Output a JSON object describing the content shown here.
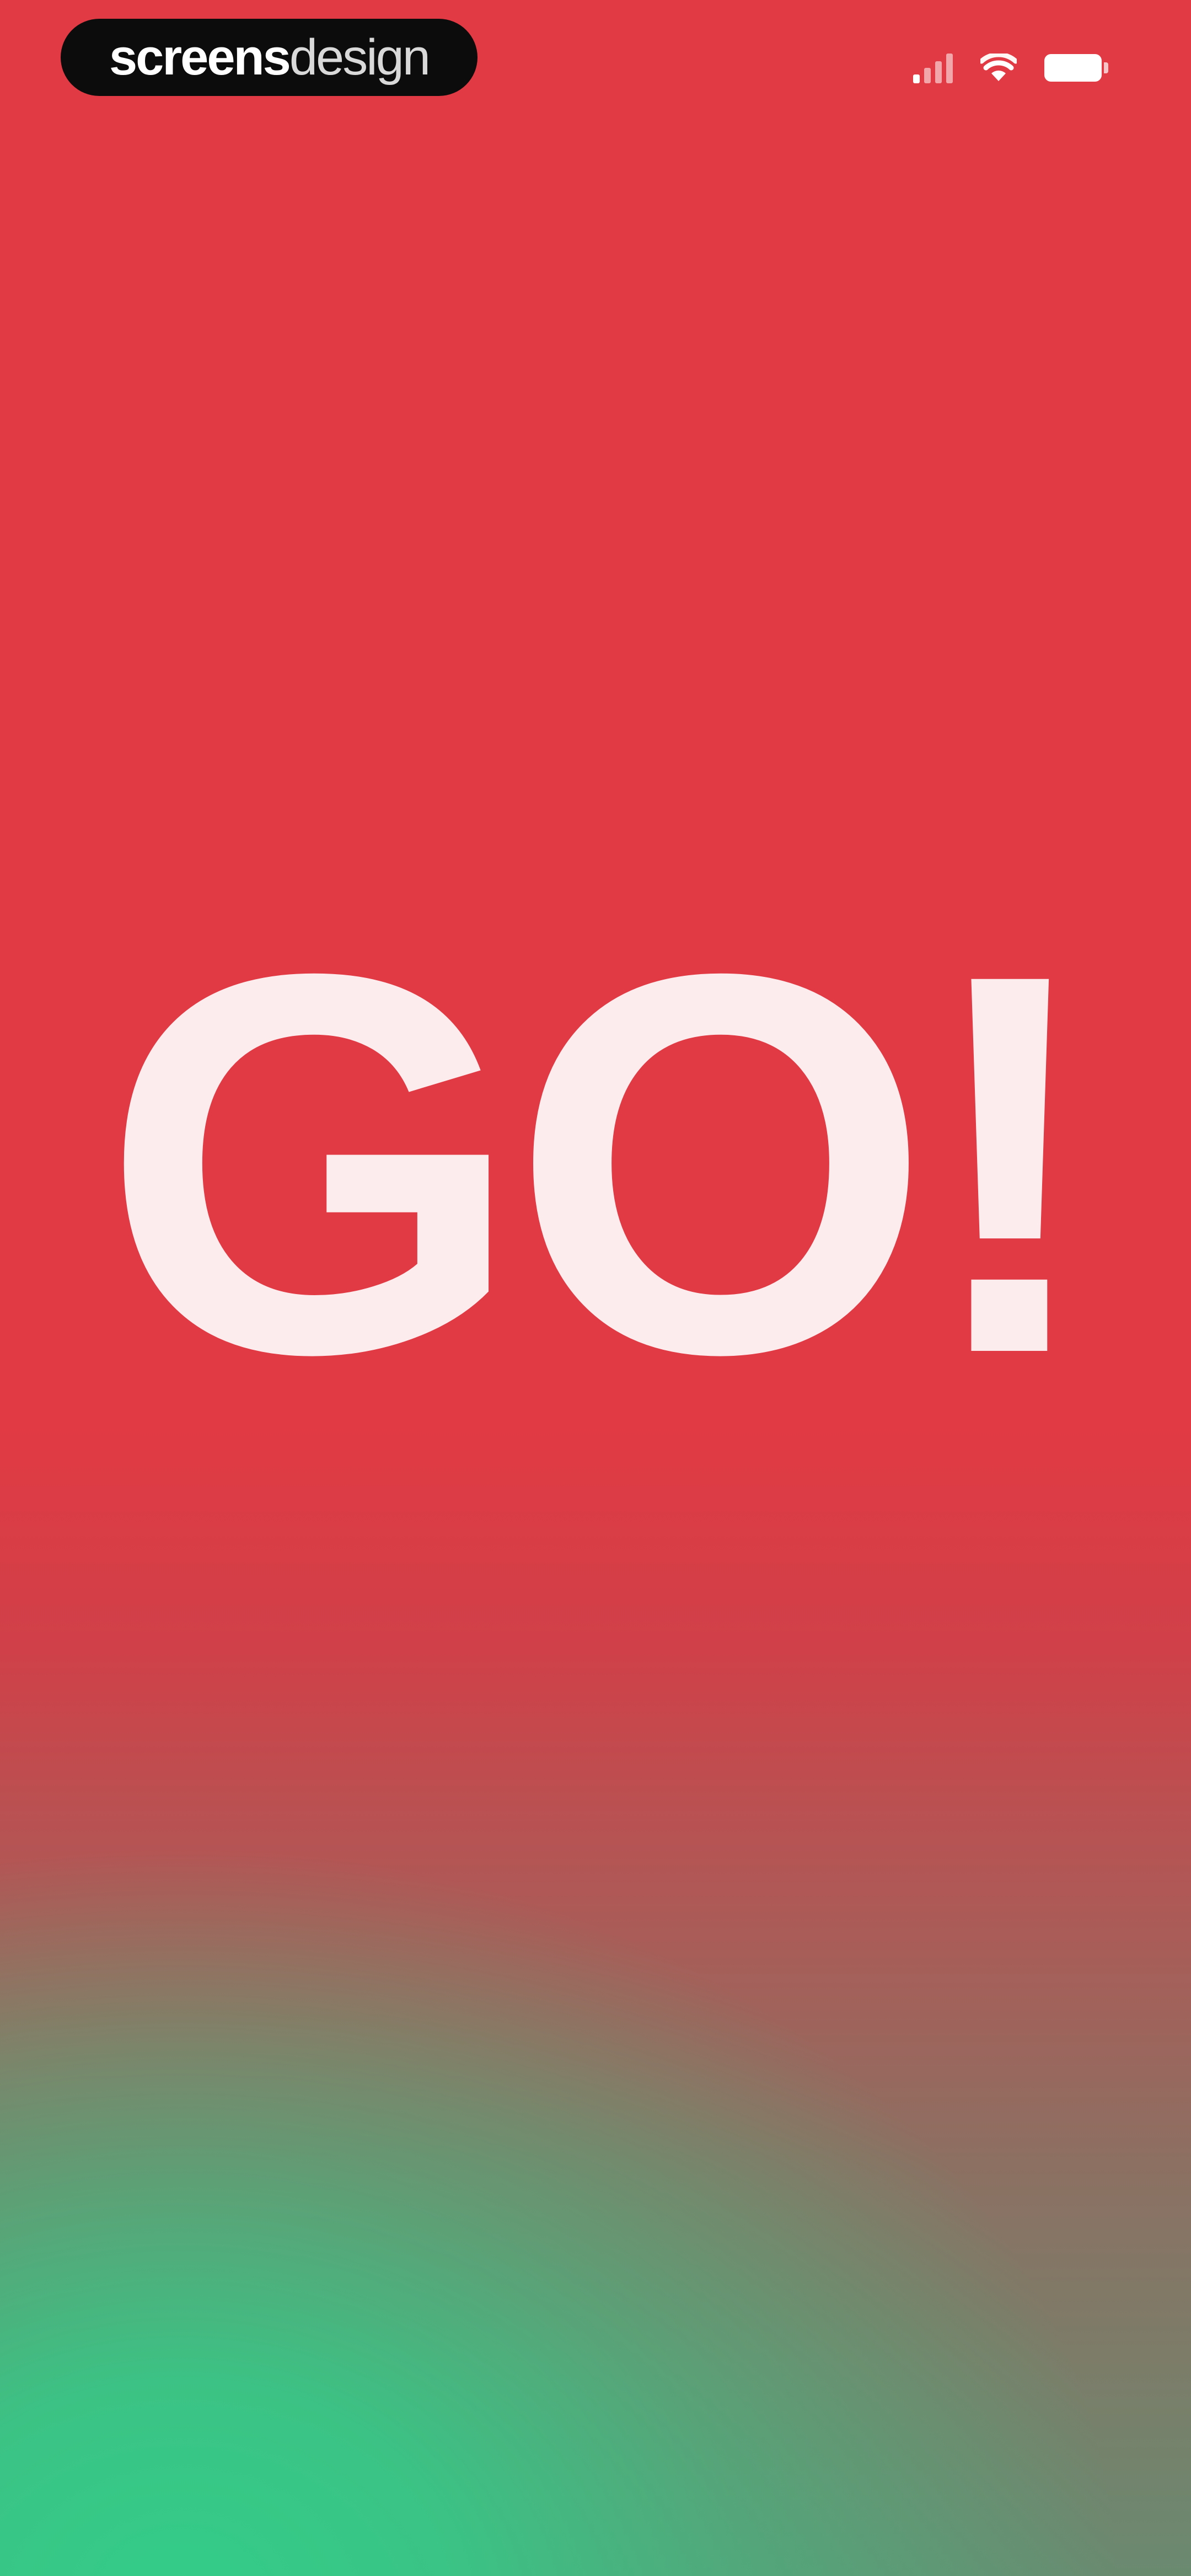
{
  "brand": {
    "bold_part": "screens",
    "light_part": "design"
  },
  "status_bar": {
    "signal_icon": "cellular-signal-icon",
    "wifi_icon": "wifi-icon",
    "battery_icon": "battery-icon",
    "signal_bars_active": 1,
    "signal_bars_total": 4
  },
  "main": {
    "headline": "GO!"
  },
  "colors": {
    "background_top": "#E23A44",
    "background_bottom": "#33CC88",
    "headline": "#FCECEE",
    "brand_pill": "#0C0C0C"
  }
}
